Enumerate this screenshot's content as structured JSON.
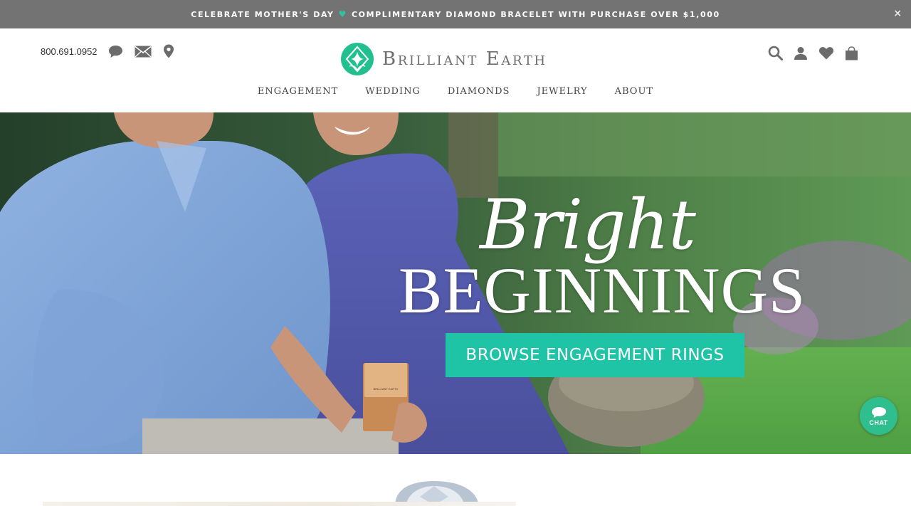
{
  "promo": {
    "text_before": "CELEBRATE MOTHER'S DAY",
    "separator": "♥",
    "text_after": "COMPLIMENTARY DIAMOND BRACELET WITH PURCHASE OVER $1,000",
    "close": "×"
  },
  "header": {
    "phone": "800.691.0952",
    "contact_icons": [
      "chat-bubble-icon",
      "mail-icon",
      "location-pin-icon"
    ],
    "logo": {
      "text": "Brilliant Earth"
    },
    "utility_icons": [
      "search-icon",
      "account-icon",
      "wishlist-heart-icon",
      "shopping-bag-icon"
    ]
  },
  "nav": {
    "items": [
      {
        "label": "ENGAGEMENT"
      },
      {
        "label": "WEDDING"
      },
      {
        "label": "DIAMONDS"
      },
      {
        "label": "JEWELRY"
      },
      {
        "label": "ABOUT"
      }
    ]
  },
  "hero": {
    "script": "Bright",
    "title": "BEGINNINGS",
    "cta": "BROWSE ENGAGEMENT RINGS",
    "box_label": "BRILLIANT EARTH"
  },
  "chat": {
    "label": "CHAT"
  },
  "colors": {
    "accent": "#1fc4a7",
    "promo_bg": "#737373",
    "logo_green": "#2ec4a0"
  }
}
